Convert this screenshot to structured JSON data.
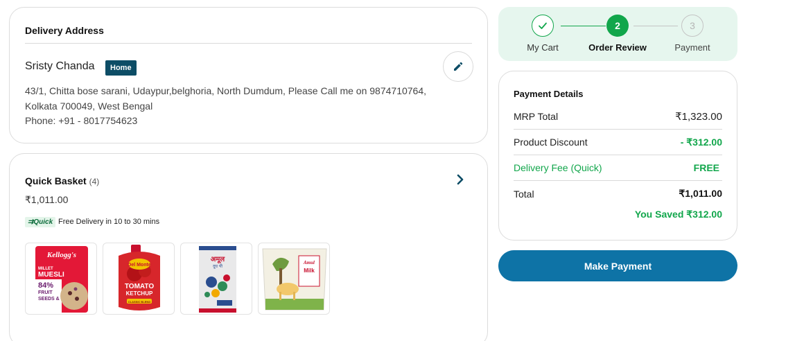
{
  "colors": {
    "brand_blue": "#0e73a6",
    "success_green": "#11a64b",
    "stepper_bg": "#e6f6ee",
    "badge_bg": "#0d4d66"
  },
  "delivery": {
    "heading": "Delivery Address",
    "name": "Sristy Chanda",
    "tag": "Home",
    "address_line1": "43/1, Chitta bose sarani, Udaypur,belghoria, North Dumdum, Please Call me on 9874710764,",
    "address_line2": "Kolkata 700049, West Bengal",
    "phone": "Phone: +91 - 8017754623",
    "edit_icon": "pencil-icon"
  },
  "basket": {
    "title": "Quick Basket",
    "count": "(4)",
    "amount": "₹1,011.00",
    "quick_tag": "Quick",
    "delivery_message": "Free Delivery in 10 to 30 mins",
    "expand_icon": "chevron-right-icon",
    "products": [
      {
        "name": "Kellogg's Millet Muesli",
        "brand": "Kellogg's",
        "line1": "MILLET",
        "line2": "MUESLI",
        "line3": "84%",
        "line4": "FRUIT",
        "line5": "SEEDS &"
      },
      {
        "name": "Del Monte Tomato Ketchup",
        "brand": "Del Monte",
        "line1": "TOMATO",
        "line2": "KETCHUP",
        "line3": "CLASSIC BLEND"
      },
      {
        "name": "Amul Milk Powder",
        "brand": "अमूल",
        "line1": "दूध पी"
      },
      {
        "name": "Amul Milk Pouch",
        "brand": "Amul",
        "line1": "Milk"
      }
    ]
  },
  "stepper": {
    "steps": [
      {
        "label": "My Cart",
        "number": "✓",
        "state": "done"
      },
      {
        "label": "Order Review",
        "number": "2",
        "state": "active"
      },
      {
        "label": "Payment",
        "number": "3",
        "state": "pending"
      }
    ]
  },
  "payment": {
    "heading": "Payment Details",
    "rows": [
      {
        "label": "MRP Total",
        "value": "₹1,323.00"
      },
      {
        "label": "Product Discount",
        "value": "- ₹312.00"
      },
      {
        "label": "Delivery Fee (Quick)",
        "value": "FREE"
      },
      {
        "label": "Total",
        "value": "₹1,011.00"
      }
    ],
    "saved": "You Saved ₹312.00",
    "button_label": "Make Payment"
  }
}
